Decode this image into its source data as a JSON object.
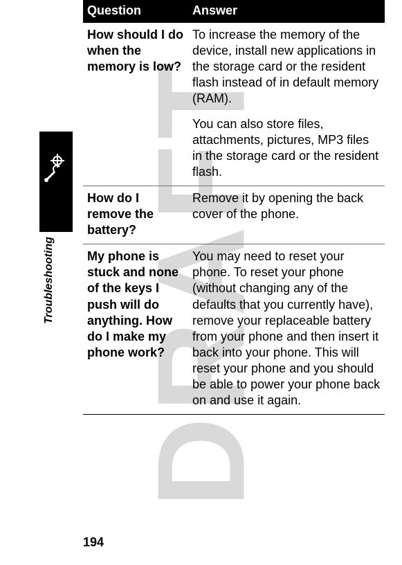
{
  "watermark": "DRAFT",
  "side_label": "Troubleshooting",
  "page_number": "194",
  "headers": {
    "q": "Question",
    "a": "Answer"
  },
  "rows": [
    {
      "q": "How should I do when the memory is low?",
      "a": [
        "To increase the memory of the device, install new applications in the storage card or the resident flash instead of in default memory (RAM).",
        "You can also store files, attachments, pictures, MP3 files in the storage card or the resident flash."
      ]
    },
    {
      "q": "How do I remove the battery?",
      "a": [
        "Remove it by opening the back cover of the phone."
      ]
    },
    {
      "q": "My phone is stuck and none of the keys I push will do anything. How do I make my phone work?",
      "a": [
        "You may need to reset your phone. To reset your phone (without changing any of the defaults that you currently have), remove your replaceable battery from your phone and then insert it back into your phone. This will reset your phone and you should be able to power your phone back on and use it again."
      ]
    }
  ]
}
